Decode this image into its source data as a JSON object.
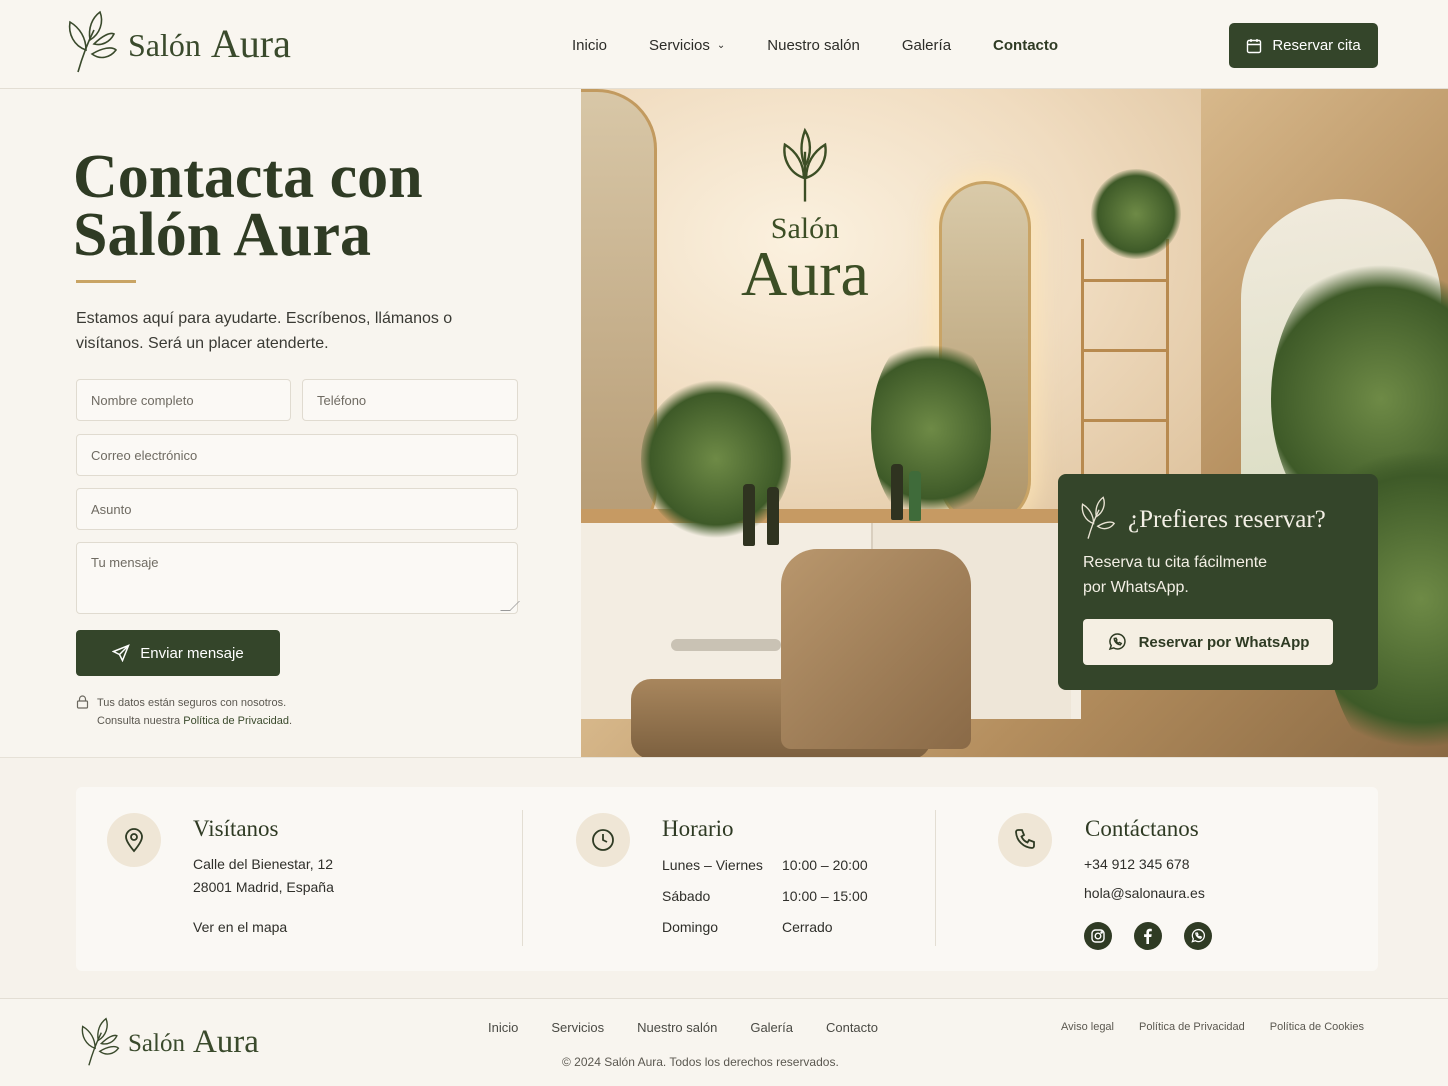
{
  "brand": {
    "name_part1": "Salón",
    "name_part2": "Aura"
  },
  "nav": {
    "items": [
      "Inicio",
      "Servicios",
      "Nuestro salón",
      "Galería",
      "Contacto"
    ],
    "active": "Contacto",
    "reserve_label": "Reservar cita"
  },
  "hero": {
    "title_line1": "Contacta con",
    "title_line2": "Salón Aura",
    "intro": "Estamos aquí para ayudarte. Escríbenos, llámanos o visítanos. Será un placer atenderte."
  },
  "form": {
    "name_placeholder": "Nombre completo",
    "phone_placeholder": "Teléfono",
    "email_placeholder": "Correo electrónico",
    "subject_placeholder": "Asunto",
    "message_placeholder": "Tu mensaje",
    "submit_label": "Enviar mensaje",
    "privacy_line1": "Tus datos están seguros con nosotros.",
    "privacy_line2_prefix": "Consulta nuestra",
    "privacy_link": "Política de Privacidad",
    "privacy_suffix": "."
  },
  "photo_sign": {
    "line1": "Salón",
    "line2": "Aura"
  },
  "whatsapp_card": {
    "title": "¿Prefieres reservar?",
    "text": "Reserva tu cita fácilmente por WhatsApp.",
    "button_label": "Reservar por WhatsApp"
  },
  "info": {
    "visit": {
      "title": "Visítanos",
      "address1": "Calle del Bienestar, 12",
      "address2": "28001 Madrid, España",
      "map_link": "Ver en el mapa"
    },
    "hours": {
      "title": "Horario",
      "rows": [
        {
          "day": "Lunes – Viernes",
          "time": "10:00 – 20:00"
        },
        {
          "day": "Sábado",
          "time": "10:00 – 15:00"
        },
        {
          "day": "Domingo",
          "time": "Cerrado"
        }
      ]
    },
    "contact": {
      "title": "Contáctanos",
      "phone": "+34 912 345 678",
      "email": "hola@salonaura.es",
      "social": [
        "instagram-icon",
        "facebook-icon",
        "whatsapp-icon"
      ]
    }
  },
  "footer": {
    "nav": [
      "Inicio",
      "Servicios",
      "Nuestro salón",
      "Galería",
      "Contacto"
    ],
    "copyright": "© 2024 Salón Aura. Todos los derechos reservados.",
    "legal": [
      "Aviso legal",
      "Política de Privacidad",
      "Política de Cookies"
    ]
  },
  "colors": {
    "primary": "#34452a",
    "accent": "#c9a464",
    "background": "#f8f5ef"
  }
}
